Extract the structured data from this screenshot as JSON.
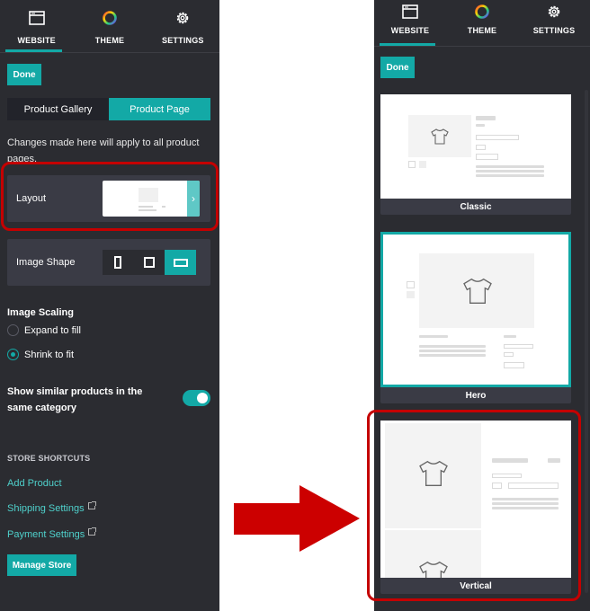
{
  "tabs": [
    {
      "label": "WEBSITE",
      "icon": "browser-window-icon",
      "active": true
    },
    {
      "label": "THEME",
      "icon": "color-wheel-icon",
      "active": false
    },
    {
      "label": "SETTINGS",
      "icon": "gear-icon",
      "active": false
    }
  ],
  "left_panel": {
    "done_label": "Done",
    "segments": [
      {
        "label": "Product Gallery",
        "active": false
      },
      {
        "label": "Product Page",
        "active": true
      }
    ],
    "note": "Changes made here will apply to all product pages.",
    "layout_label": "Layout",
    "layout_chevron": "›",
    "image_shape_label": "Image Shape",
    "image_shape_options": [
      "portrait",
      "square",
      "landscape"
    ],
    "image_shape_selected": "landscape",
    "image_scaling_title": "Image Scaling",
    "scaling_options": [
      {
        "label": "Expand to fill",
        "checked": false
      },
      {
        "label": "Shrink to fit",
        "checked": true
      }
    ],
    "similar_products_label": "Show similar products in the same category",
    "similar_products_enabled": true,
    "shortcuts_title": "STORE SHORTCUTS",
    "shortcuts": [
      {
        "label": "Add Product",
        "external": false
      },
      {
        "label": "Shipping Settings",
        "external": true
      },
      {
        "label": "Payment Settings",
        "external": true
      }
    ],
    "manage_store_label": "Manage Store"
  },
  "right_panel": {
    "done_label": "Done",
    "layout_options": [
      {
        "label": "Classic",
        "selected": false
      },
      {
        "label": "Hero",
        "selected": true
      },
      {
        "label": "Vertical",
        "selected": false,
        "highlighted": true
      }
    ]
  },
  "colors": {
    "accent": "#13a9a6",
    "panel_bg": "#2b2c31",
    "card_bg": "#3a3b45",
    "highlight": "#c40000",
    "link": "#4fd1cc"
  }
}
